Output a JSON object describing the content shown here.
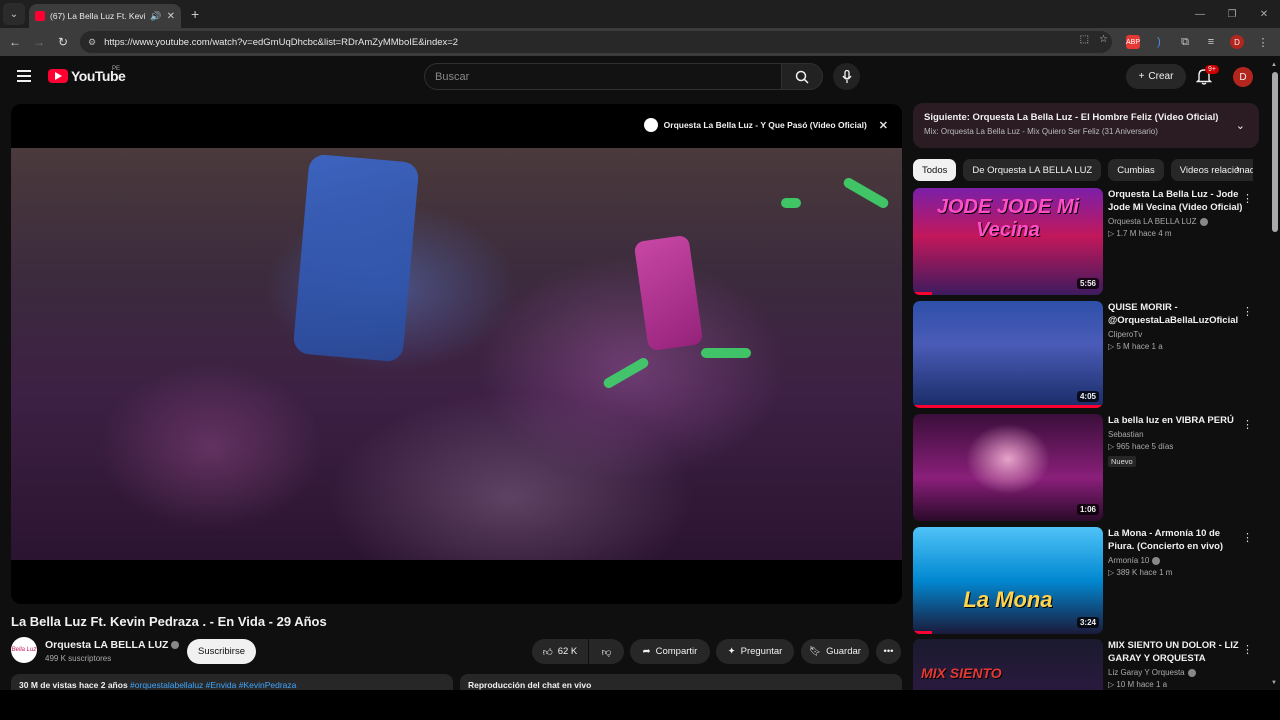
{
  "browser": {
    "tab_title": "(67) La Bella Luz Ft. Kevin Pe",
    "new_tab": "+",
    "url": "https://www.youtube.com/watch?v=edGmUqDhcbc&list=RDrAmZyMMboIE&index=2"
  },
  "header": {
    "logo_text": "YouTube",
    "region": "PE",
    "search_placeholder": "Buscar",
    "create_label": "Crear",
    "notification_count": "9+",
    "user_initial": "D"
  },
  "player": {
    "overlay_title": "Orquesta La Bella Luz - Y Que Pasó (Video Oficial)"
  },
  "video": {
    "title": "La Bella Luz Ft. Kevin Pedraza . - En Vida - 29 Años",
    "channel": "Orquesta LA BELLA LUZ",
    "subscribers": "499 K suscriptores",
    "subscribe_label": "Suscribirse",
    "likes": "62 K",
    "share_label": "Compartir",
    "ask_label": "Preguntar",
    "save_label": "Guardar",
    "description_stats": "30 M de vistas  hace 2 años",
    "description_tags": "#orquestalabellaluz #Envida #KevinPedraza",
    "chat_replay": "Reproducción del chat en vivo"
  },
  "up_next": {
    "next": "Siguiente: Orquesta La Bella Luz - El Hombre Feliz (Video Oficial)",
    "mix": "Mix: Orquesta La Bella Luz - Mix Quiero Ser Feliz (31 Aniversario)"
  },
  "chips": [
    "Todos",
    "De Orquesta LA BELLA LUZ",
    "Cumbias",
    "Videos relacionados"
  ],
  "recommendations": [
    {
      "title": "Orquesta La Bella Luz - Jode Jode Mi Vecina (Video Oficial)",
      "channel": "Orquesta LA BELLA LUZ",
      "verified": true,
      "views": "1.7 M",
      "age": "hace 4 m",
      "duration": "5:56",
      "thumb_text": "JODE JODE Mi Vecina",
      "is_new": false,
      "progress": 0.1
    },
    {
      "title": "QUISE MORIR - @OrquestaLaBellaLuzOficial",
      "channel": "CliperoTv",
      "verified": false,
      "views": "5 M",
      "age": "hace 1 a",
      "duration": "4:05",
      "thumb_text": "",
      "is_new": false,
      "progress": 1.0
    },
    {
      "title": "La bella luz en VIBRA PERÚ",
      "channel": "Sebastian",
      "verified": false,
      "views": "965",
      "age": "hace 5 días",
      "duration": "1:06",
      "thumb_text": "",
      "is_new": true,
      "new_label": "Nuevo",
      "progress": 0
    },
    {
      "title": "La Mona - Armonía 10 de Piura. (Concierto en vivo)",
      "channel": "Armonía 10",
      "verified": true,
      "views": "389 K",
      "age": "hace 1 m",
      "duration": "3:24",
      "thumb_text": "La Mona",
      "is_new": false,
      "progress": 0.1
    },
    {
      "title": "MIX SIENTO UN DOLOR - LIZ GARAY Y ORQUESTA",
      "channel": "Liz Garay Y Orquesta",
      "verified": true,
      "views": "10 M",
      "age": "hace 1 a",
      "duration": "",
      "thumb_text": "MIX SIENTO",
      "is_new": false,
      "progress": 0
    }
  ],
  "colors": {
    "accent": "#ff0033",
    "background": "#0f0f0f",
    "link": "#3ea6ff"
  }
}
